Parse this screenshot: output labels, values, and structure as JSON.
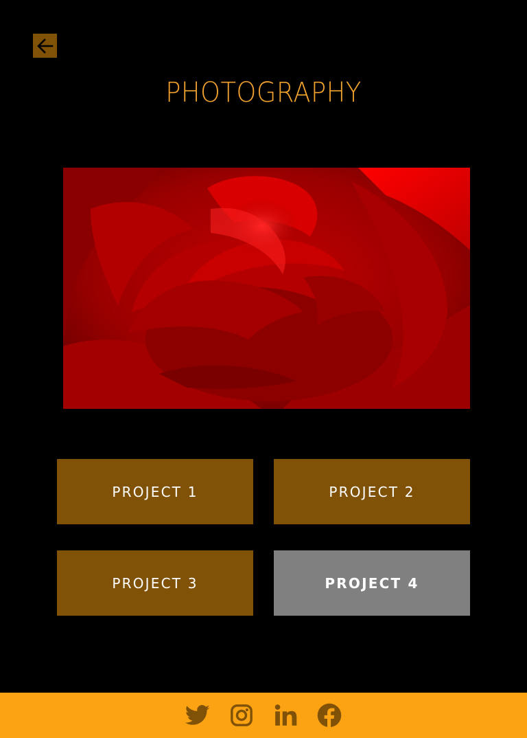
{
  "header": {
    "back_icon": "arrow-left-icon",
    "title": "PHOTOGRAPHY"
  },
  "hero": {
    "subject_icon": "red-rose-photo"
  },
  "projects": [
    {
      "label": "PROJECT 1",
      "state": "default"
    },
    {
      "label": "PROJECT 2",
      "state": "default"
    },
    {
      "label": "PROJECT 3",
      "state": "default"
    },
    {
      "label": "PROJECT 4",
      "state": "active"
    }
  ],
  "footer": {
    "social": [
      {
        "icon": "twitter-icon"
      },
      {
        "icon": "instagram-icon"
      },
      {
        "icon": "linkedin-icon"
      },
      {
        "icon": "facebook-icon"
      }
    ]
  },
  "colors": {
    "background": "#000000",
    "title": "#f2a22d",
    "button": "#7f5208",
    "button_active": "#808080",
    "footer": "#fba313",
    "footer_icon": "#7f5208"
  }
}
